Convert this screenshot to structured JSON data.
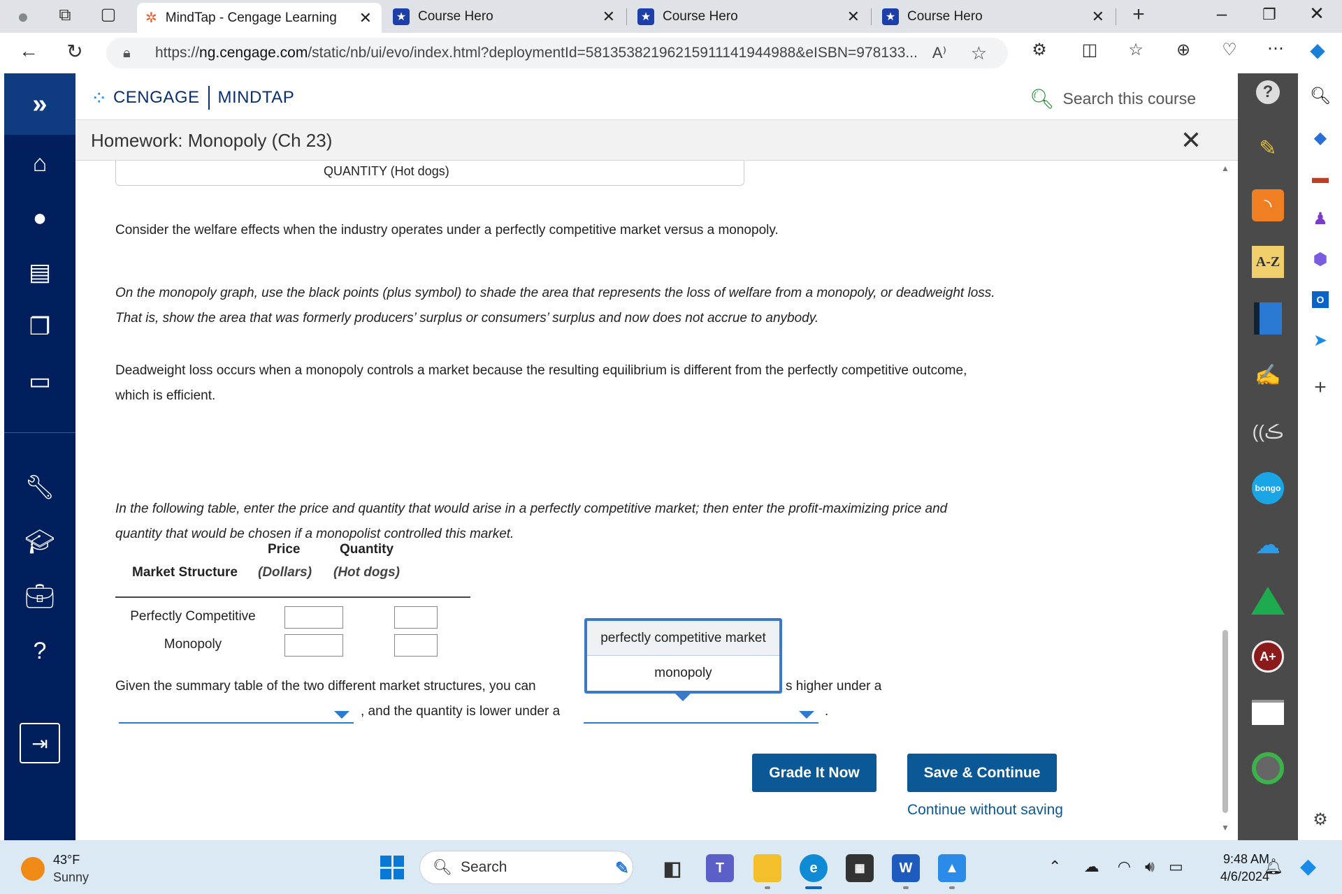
{
  "browser": {
    "tabs": [
      {
        "title": "MindTap - Cengage Learning"
      },
      {
        "title": "Course Hero"
      },
      {
        "title": "Course Hero"
      },
      {
        "title": "Course Hero"
      }
    ],
    "url_prefix": "https://",
    "url_host": "ng.cengage.com",
    "url_path": "/static/nb/ui/evo/index.html?deploymentId=58135382196215911141944988&eISBN=978133..."
  },
  "header": {
    "brand_left": "CENGAGE",
    "brand_right": "MINDTAP",
    "search_placeholder": "Search this course"
  },
  "activity": {
    "title": "Homework: Monopoly (Ch 23)"
  },
  "content": {
    "graph_axis_label": "QUANTITY (Hot dogs)",
    "para1": "Consider the welfare effects when the industry operates under a perfectly competitive market versus a monopoly.",
    "para2_line1": "On the monopoly graph, use the black points (plus symbol) to shade the area that represents the loss of welfare from a monopoly, or deadweight loss.",
    "para2_line2": "That is, show the area that was formerly producers’ surplus or consumers’ surplus and now does not accrue to anybody.",
    "para3_line1": "Deadweight loss occurs when a monopoly controls a market because the resulting equilibrium is different from the perfectly competitive outcome,",
    "para3_line2": "which is efficient.",
    "para4_line1": "In the following table, enter the price and quantity that would arise in a perfectly competitive market; then enter the profit-maximizing price and",
    "para4_line2": "quantity that would be chosen if a monopolist controlled this market.",
    "table": {
      "col_price": "Price",
      "col_price_unit": "(Dollars)",
      "col_qty": "Quantity",
      "col_qty_unit": "(Hot dogs)",
      "col_structure": "Market Structure",
      "rows": [
        {
          "label": "Perfectly Competitive",
          "price": "",
          "quantity": ""
        },
        {
          "label": "Monopoly",
          "price": "",
          "quantity": ""
        }
      ]
    },
    "summary_1": "Given the summary table of the two different market structures, you can",
    "summary_2": "s higher under a",
    "summary_3": ", and the quantity is lower under a",
    "summary_4": ".",
    "dropdown_options": [
      "perfectly competitive market",
      "monopoly"
    ],
    "grade_button": "Grade It Now",
    "save_button": "Save & Continue",
    "continue_link": "Continue without saving"
  },
  "taskbar": {
    "temperature": "43°F",
    "condition": "Sunny",
    "search_label": "Search",
    "time": "9:48 AM",
    "date": "4/6/2024"
  },
  "toolrail": {
    "az_label": "A-Z",
    "bongo_label": "bongo"
  }
}
